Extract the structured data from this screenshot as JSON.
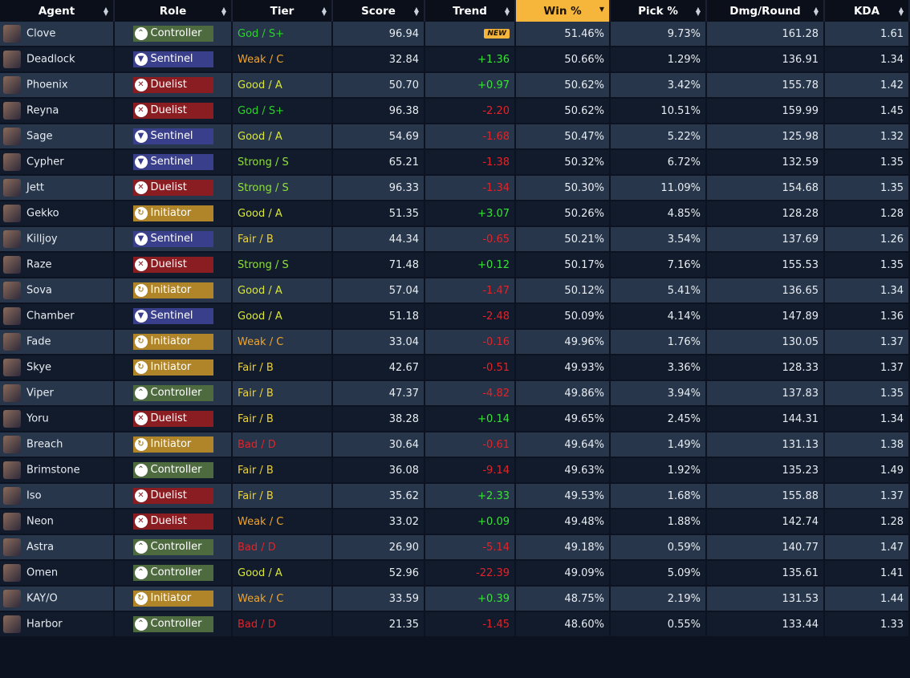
{
  "headers": [
    {
      "label": "Agent",
      "active": false
    },
    {
      "label": "Role",
      "active": false
    },
    {
      "label": "Tier",
      "active": false
    },
    {
      "label": "Score",
      "active": false
    },
    {
      "label": "Trend",
      "active": false
    },
    {
      "label": "Win %",
      "active": true
    },
    {
      "label": "Pick %",
      "active": false
    },
    {
      "label": "Dmg/Round",
      "active": false
    },
    {
      "label": "KDA",
      "active": false
    }
  ],
  "roles": {
    "Controller": {
      "color": "#4e6b3f",
      "icon": "controller-icon",
      "glyph": "⌃"
    },
    "Sentinel": {
      "color": "#3a3f8c",
      "icon": "sentinel-icon",
      "glyph": "▼"
    },
    "Duelist": {
      "color": "#8a1d22",
      "icon": "duelist-icon",
      "glyph": "✕"
    },
    "Initiator": {
      "color": "#b08529",
      "icon": "initiator-icon",
      "glyph": "↻"
    }
  },
  "tier_colors": {
    "God / S+": "#2ad32a",
    "Strong / S": "#8fe03a",
    "Good / A": "#d8e63a",
    "Fair / B": "#ecd23a",
    "Weak / C": "#f2a428",
    "Bad / D": "#e0242a"
  },
  "trend_colors": {
    "up": "#3be13b",
    "down": "#e0242a"
  },
  "new_label": "NEW",
  "rows": [
    {
      "agent": "Clove",
      "role": "Controller",
      "tier": "God / S+",
      "score": "96.94",
      "trend": "NEW",
      "win": "51.46%",
      "pick": "9.73%",
      "dmg": "161.28",
      "kda": "1.61"
    },
    {
      "agent": "Deadlock",
      "role": "Sentinel",
      "tier": "Weak / C",
      "score": "32.84",
      "trend": "+1.36",
      "win": "50.66%",
      "pick": "1.29%",
      "dmg": "136.91",
      "kda": "1.34"
    },
    {
      "agent": "Phoenix",
      "role": "Duelist",
      "tier": "Good / A",
      "score": "50.70",
      "trend": "+0.97",
      "win": "50.62%",
      "pick": "3.42%",
      "dmg": "155.78",
      "kda": "1.42"
    },
    {
      "agent": "Reyna",
      "role": "Duelist",
      "tier": "God / S+",
      "score": "96.38",
      "trend": "-2.20",
      "win": "50.62%",
      "pick": "10.51%",
      "dmg": "159.99",
      "kda": "1.45"
    },
    {
      "agent": "Sage",
      "role": "Sentinel",
      "tier": "Good / A",
      "score": "54.69",
      "trend": "-1.68",
      "win": "50.47%",
      "pick": "5.22%",
      "dmg": "125.98",
      "kda": "1.32"
    },
    {
      "agent": "Cypher",
      "role": "Sentinel",
      "tier": "Strong / S",
      "score": "65.21",
      "trend": "-1.38",
      "win": "50.32%",
      "pick": "6.72%",
      "dmg": "132.59",
      "kda": "1.35"
    },
    {
      "agent": "Jett",
      "role": "Duelist",
      "tier": "Strong / S",
      "score": "96.33",
      "trend": "-1.34",
      "win": "50.30%",
      "pick": "11.09%",
      "dmg": "154.68",
      "kda": "1.35"
    },
    {
      "agent": "Gekko",
      "role": "Initiator",
      "tier": "Good / A",
      "score": "51.35",
      "trend": "+3.07",
      "win": "50.26%",
      "pick": "4.85%",
      "dmg": "128.28",
      "kda": "1.28"
    },
    {
      "agent": "Killjoy",
      "role": "Sentinel",
      "tier": "Fair / B",
      "score": "44.34",
      "trend": "-0.65",
      "win": "50.21%",
      "pick": "3.54%",
      "dmg": "137.69",
      "kda": "1.26"
    },
    {
      "agent": "Raze",
      "role": "Duelist",
      "tier": "Strong / S",
      "score": "71.48",
      "trend": "+0.12",
      "win": "50.17%",
      "pick": "7.16%",
      "dmg": "155.53",
      "kda": "1.35"
    },
    {
      "agent": "Sova",
      "role": "Initiator",
      "tier": "Good / A",
      "score": "57.04",
      "trend": "-1.47",
      "win": "50.12%",
      "pick": "5.41%",
      "dmg": "136.65",
      "kda": "1.34"
    },
    {
      "agent": "Chamber",
      "role": "Sentinel",
      "tier": "Good / A",
      "score": "51.18",
      "trend": "-2.48",
      "win": "50.09%",
      "pick": "4.14%",
      "dmg": "147.89",
      "kda": "1.36"
    },
    {
      "agent": "Fade",
      "role": "Initiator",
      "tier": "Weak / C",
      "score": "33.04",
      "trend": "-0.16",
      "win": "49.96%",
      "pick": "1.76%",
      "dmg": "130.05",
      "kda": "1.37"
    },
    {
      "agent": "Skye",
      "role": "Initiator",
      "tier": "Fair / B",
      "score": "42.67",
      "trend": "-0.51",
      "win": "49.93%",
      "pick": "3.36%",
      "dmg": "128.33",
      "kda": "1.37"
    },
    {
      "agent": "Viper",
      "role": "Controller",
      "tier": "Fair / B",
      "score": "47.37",
      "trend": "-4.82",
      "win": "49.86%",
      "pick": "3.94%",
      "dmg": "137.83",
      "kda": "1.35"
    },
    {
      "agent": "Yoru",
      "role": "Duelist",
      "tier": "Fair / B",
      "score": "38.28",
      "trend": "+0.14",
      "win": "49.65%",
      "pick": "2.45%",
      "dmg": "144.31",
      "kda": "1.34"
    },
    {
      "agent": "Breach",
      "role": "Initiator",
      "tier": "Bad / D",
      "score": "30.64",
      "trend": "-0.61",
      "win": "49.64%",
      "pick": "1.49%",
      "dmg": "131.13",
      "kda": "1.38"
    },
    {
      "agent": "Brimstone",
      "role": "Controller",
      "tier": "Fair / B",
      "score": "36.08",
      "trend": "-9.14",
      "win": "49.63%",
      "pick": "1.92%",
      "dmg": "135.23",
      "kda": "1.49"
    },
    {
      "agent": "Iso",
      "role": "Duelist",
      "tier": "Fair / B",
      "score": "35.62",
      "trend": "+2.33",
      "win": "49.53%",
      "pick": "1.68%",
      "dmg": "155.88",
      "kda": "1.37"
    },
    {
      "agent": "Neon",
      "role": "Duelist",
      "tier": "Weak / C",
      "score": "33.02",
      "trend": "+0.09",
      "win": "49.48%",
      "pick": "1.88%",
      "dmg": "142.74",
      "kda": "1.28"
    },
    {
      "agent": "Astra",
      "role": "Controller",
      "tier": "Bad / D",
      "score": "26.90",
      "trend": "-5.14",
      "win": "49.18%",
      "pick": "0.59%",
      "dmg": "140.77",
      "kda": "1.47"
    },
    {
      "agent": "Omen",
      "role": "Controller",
      "tier": "Good / A",
      "score": "52.96",
      "trend": "-22.39",
      "win": "49.09%",
      "pick": "5.09%",
      "dmg": "135.61",
      "kda": "1.41"
    },
    {
      "agent": "KAY/O",
      "role": "Initiator",
      "tier": "Weak / C",
      "score": "33.59",
      "trend": "+0.39",
      "win": "48.75%",
      "pick": "2.19%",
      "dmg": "131.53",
      "kda": "1.44"
    },
    {
      "agent": "Harbor",
      "role": "Controller",
      "tier": "Bad / D",
      "score": "21.35",
      "trend": "-1.45",
      "win": "48.60%",
      "pick": "0.55%",
      "dmg": "133.44",
      "kda": "1.33"
    }
  ]
}
